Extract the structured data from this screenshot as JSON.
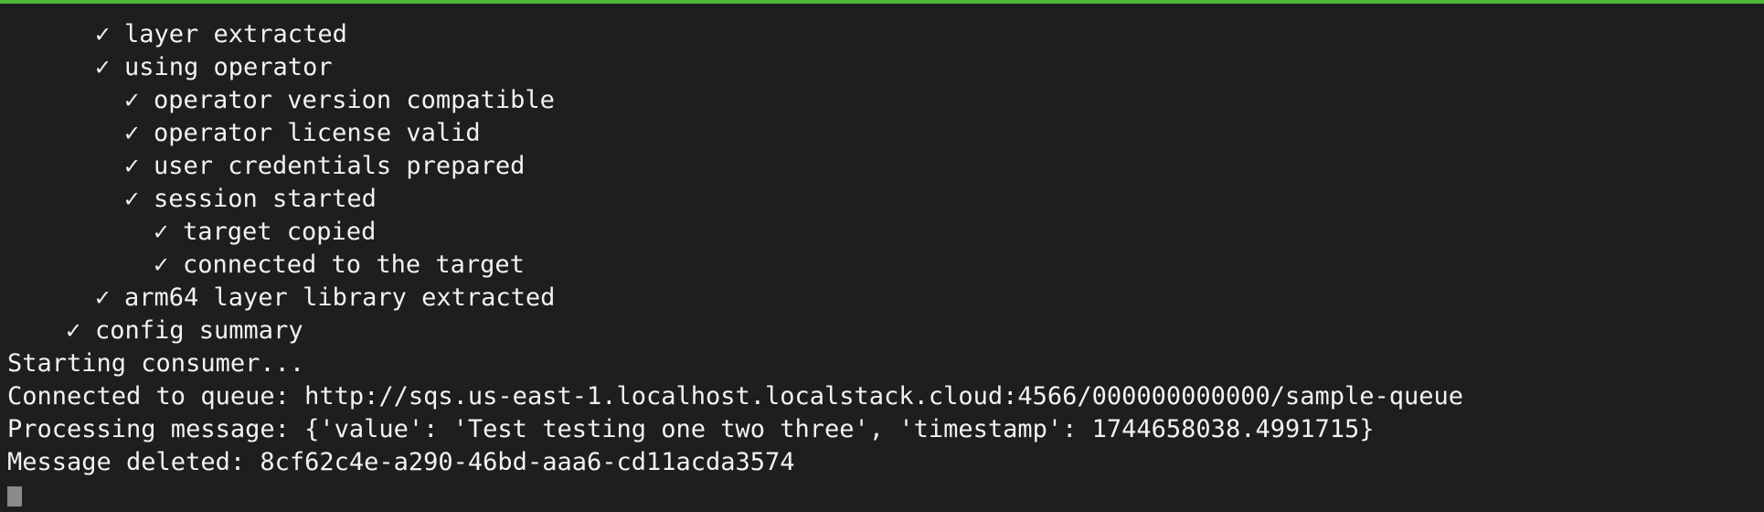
{
  "theme": {
    "background": "#1e1e1e",
    "foreground": "#f2f2f2",
    "accent": "#4fb83a",
    "cursor": "#8a8a8a"
  },
  "check_glyph": "✓",
  "status_lines": [
    {
      "indent": 3,
      "text": "layer extracted"
    },
    {
      "indent": 3,
      "text": "using operator"
    },
    {
      "indent": 4,
      "text": "operator version compatible"
    },
    {
      "indent": 4,
      "text": "operator license valid"
    },
    {
      "indent": 4,
      "text": "user credentials prepared"
    },
    {
      "indent": 4,
      "text": "session started"
    },
    {
      "indent": 5,
      "text": "target copied"
    },
    {
      "indent": 5,
      "text": "connected to the target"
    },
    {
      "indent": 3,
      "text": "arm64 layer library extracted"
    },
    {
      "indent": 2,
      "text": "config summary"
    }
  ],
  "log_lines": [
    "Starting consumer...",
    "Connected to queue: http://sqs.us-east-1.localhost.localstack.cloud:4566/000000000000/sample-queue",
    "Processing message: {'value': 'Test testing one two three', 'timestamp': 1744658038.4991715}",
    "Message deleted: 8cf62c4e-a290-46bd-aaa6-cd11acda3574"
  ]
}
